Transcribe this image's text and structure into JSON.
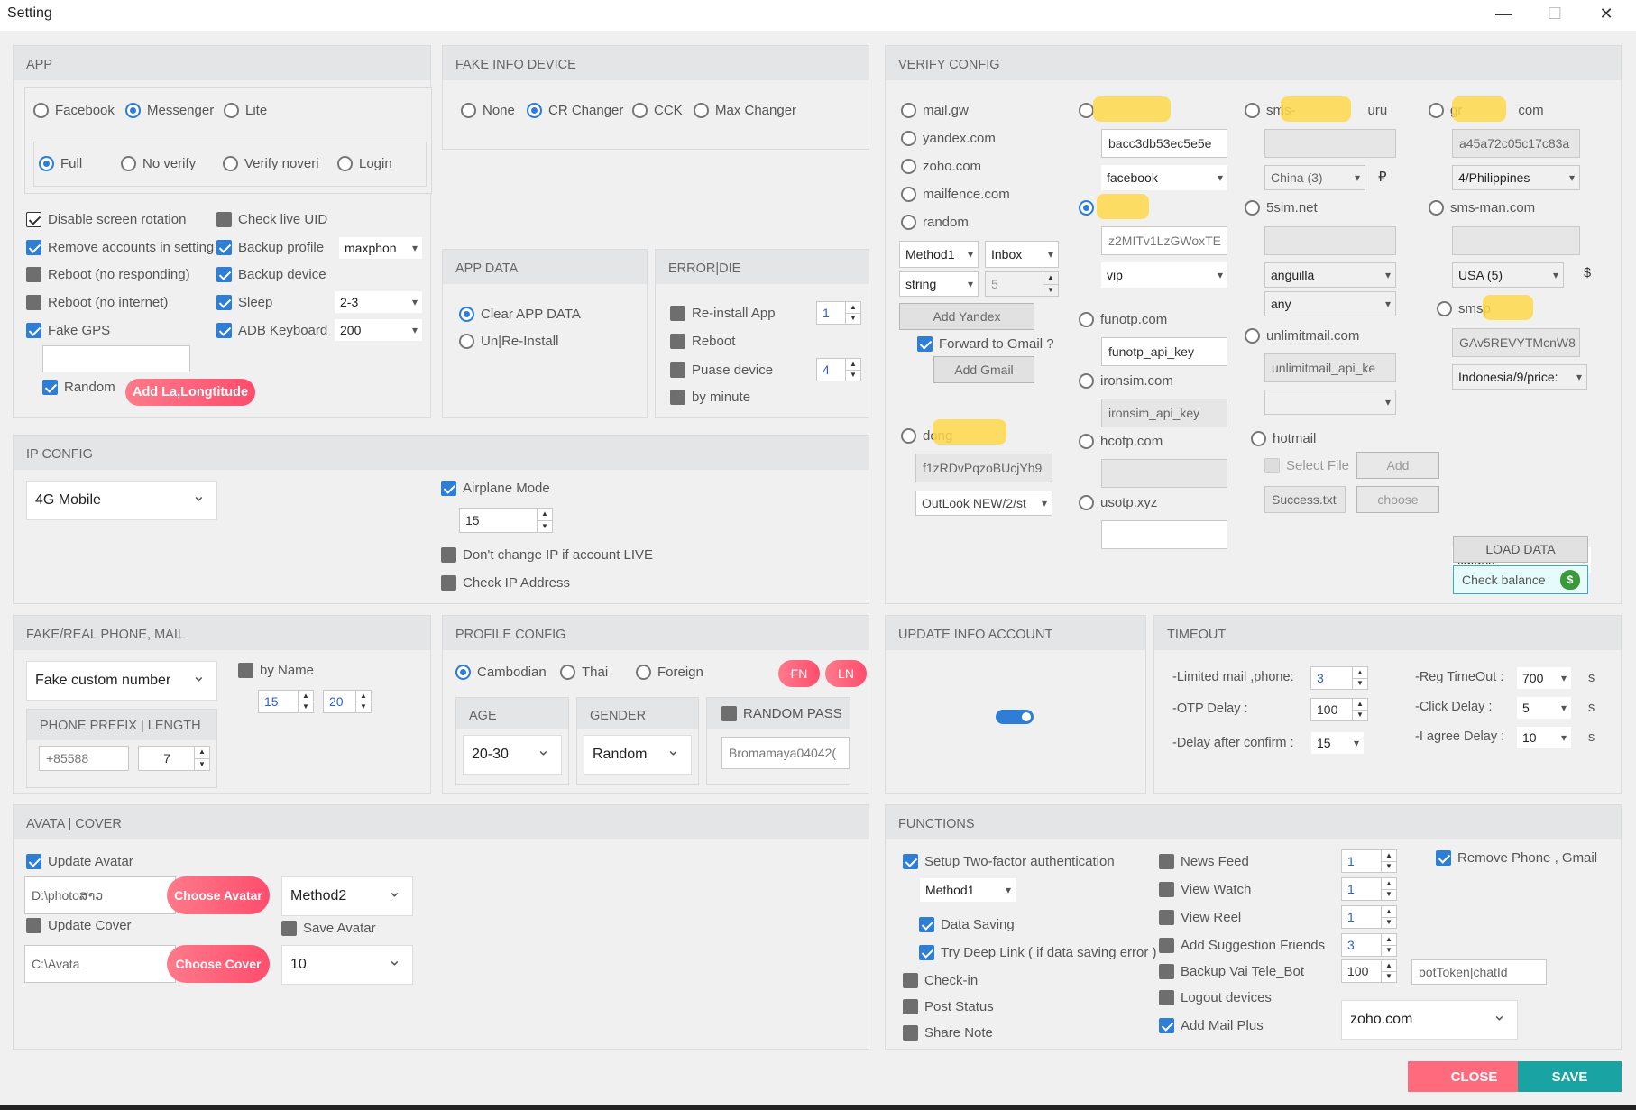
{
  "window": {
    "title": "Setting",
    "minimize": "—",
    "maximize": "☐",
    "close": "✕"
  },
  "app": {
    "title": "APP",
    "app_options": [
      "Facebook",
      "Messenger",
      "Lite"
    ],
    "mode_options": [
      "Full",
      "No verify",
      "Verify noveri",
      "Login"
    ],
    "disable_rotation": "Disable screen rotation",
    "check_live_uid": "Check live UID",
    "remove_accounts": "Remove accounts in setting",
    "backup_profile": "Backup profile",
    "backup_profile_value": "maxphon",
    "reboot_no_responding": "Reboot (no responding)",
    "backup_device": "Backup device",
    "reboot_no_internet": "Reboot (no internet)",
    "sleep": "Sleep",
    "sleep_value": "2-3",
    "fake_gps": "Fake GPS",
    "adb_keyboard": "ADB Keyboard",
    "adb_value": "200",
    "random": "Random",
    "add_latlong": "Add La,Longtitude"
  },
  "fake_info": {
    "title": "FAKE INFO DEVICE",
    "options": [
      "None",
      "CR Changer",
      "CCK",
      "Max Changer"
    ]
  },
  "app_data": {
    "title": "APP DATA",
    "clear": "Clear APP DATA",
    "reinstall": "Un|Re-Install"
  },
  "error_die": {
    "title": "ERROR|DIE",
    "reinstall_app": "Re-install App",
    "reinstall_value": "1",
    "reboot": "Reboot",
    "pause_device": "Puase device",
    "pause_value": "4",
    "by_minute": "by minute"
  },
  "verify": {
    "title": "VERIFY CONFIG",
    "mails": [
      "mail.gw",
      "yandex.com",
      "zoho.com",
      "mailfence.com",
      "random"
    ],
    "method": "Method1",
    "inbox": "Inbox",
    "string": "string",
    "num": "5",
    "add_yandex": "Add Yandex",
    "forward_gmail": "Forward to Gmail ?",
    "add_gmail": "Add Gmail",
    "dong_label": "dong",
    "dong_key": "f1zRDvPqzoBUcjYh9",
    "outlook": "OutLook NEW/2/st",
    "c2_key1": "bacc3db53ec5e5e",
    "c2_app": "facebook",
    "c2_key2": "z2MITv1LzGWoxTE",
    "c2_plan": "vip",
    "funotp": "funotp.com",
    "funotp_key": "funotp_api_key",
    "ironsim": "ironsim.com",
    "ironsim_key": "ironsim_api_key",
    "hcotp": "hcotp.com",
    "usotp": "usotp.xyz",
    "sms_label": "sms-",
    "sms_suffix": "uru",
    "china": "China (3)",
    "ruble": "₽",
    "fivesim": "5sim.net",
    "anguilla": "anguilla",
    "any": "any",
    "unlimit": "unlimitmail.com",
    "unlimit_key": "unlimitmail_api_ke",
    "hotmail": "hotmail",
    "select_file": "Select File",
    "add": "Add",
    "success_file": "Success.txt",
    "choose": "choose",
    "gr_label": "gr",
    "gr_suffix": "com",
    "gr_key": "a45a72c05c17c83a",
    "philippines": "4/Philippines",
    "smsman": "sms-man.com",
    "usa": "USA (5)",
    "dollar": "$",
    "smsp": "smsp",
    "smsp_key": "GAv5REVYTMcnW8",
    "indonesia": "Indonesia/9/price:",
    "katana": "katana",
    "load_data": "LOAD DATA",
    "check_balance": "Check balance"
  },
  "ip": {
    "title": "IP CONFIG",
    "mode": "4G Mobile",
    "airplane": "Airplane Mode",
    "airplane_value": "15",
    "dont_change": "Don't change IP if account LIVE",
    "check_ip": "Check IP Address"
  },
  "phone": {
    "title": "FAKE/REAL PHONE, MAIL",
    "mode": "Fake custom number",
    "by_name": "by Name",
    "from": "15",
    "to": "20",
    "prefix_title": "PHONE PREFIX | LENGTH",
    "prefix": "+85588",
    "length": "7"
  },
  "profile": {
    "title": "PROFILE CONFIG",
    "options": [
      "Cambodian",
      "Thai",
      "Foreign"
    ],
    "fn": "FN",
    "ln": "LN",
    "age_title": "AGE",
    "age": "20-30",
    "gender_title": "GENDER",
    "gender": "Random",
    "random_pass": "RANDOM PASS",
    "pass": "Bromamaya04042("
  },
  "update_info": {
    "title": "UPDATE INFO ACCOUNT"
  },
  "timeout": {
    "title": "TIMEOUT",
    "limited_label": "-Limited mail ,phone:",
    "limited_value": "3",
    "otp_label": "-OTP Delay :",
    "otp_value": "100",
    "delay_confirm_label": "-Delay after confirm :",
    "delay_confirm_value": "15",
    "reg_label": "-Reg TimeOut :",
    "reg_value": "700",
    "click_label": "-Click Delay :",
    "click_value": "5",
    "agree_label": "-I agree Delay :",
    "agree_value": "10",
    "unit": "s"
  },
  "avatar": {
    "title": "AVATA | COVER",
    "update_avatar": "Update Avatar",
    "avatar_path": "D:\\photoສາວ",
    "choose_avatar": "Choose Avatar",
    "method": "Method2",
    "update_cover": "Update Cover",
    "save_avatar": "Save Avatar",
    "cover_path": "C:\\Avata",
    "choose_cover": "Choose Cover",
    "count": "10"
  },
  "functions": {
    "title": "FUNCTIONS",
    "two_factor": "Setup Two-factor authentication",
    "method": "Method1",
    "data_saving": "Data Saving",
    "deep_link": "Try Deep Link ( if data saving error )",
    "checkin": "Check-in",
    "post_status": "Post Status",
    "share_note": "Share Note",
    "news_feed": "News Feed",
    "view_watch": "View Watch",
    "view_reel": "View Reel",
    "add_friends": "Add Suggestion Friends",
    "backup_bot": "Backup Vai Tele_Bot",
    "logout": "Logout devices",
    "mail_plus": "Add Mail Plus",
    "v_news": "1",
    "v_watch": "1",
    "v_reel": "1",
    "v_friends": "3",
    "v_bot": "100",
    "bot_token": "botToken|chatId",
    "mail_domain": "zoho.com",
    "remove_phone": "Remove Phone , Gmail"
  },
  "footer": {
    "close": "CLOSE",
    "save": "SAVE"
  },
  "colors": {
    "accent": "#2e7ed6",
    "pink": "#ff5470",
    "teal": "#1aa3a3"
  }
}
